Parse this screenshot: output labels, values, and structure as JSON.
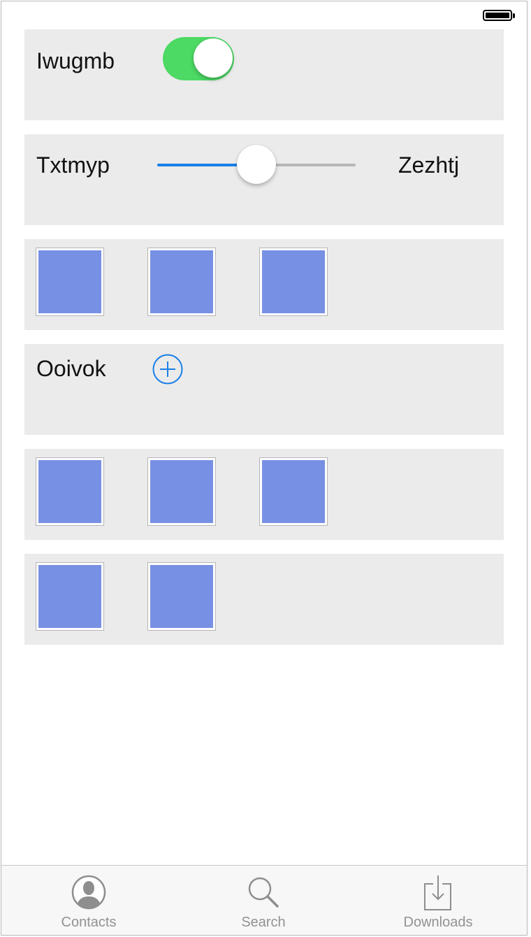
{
  "status_bar": {
    "battery_icon": "battery-icon",
    "battery_level": 1.0
  },
  "rows": {
    "toggle_row": {
      "label": "Iwugmb",
      "toggle_on": true,
      "toggle_color": "#4cd964"
    },
    "slider_row": {
      "left_label": "Txtmyp",
      "right_label": "Zezhtj",
      "value_fraction": 0.5,
      "accent_color": "#1a7fe8"
    },
    "image_row_1": {
      "tile_count": 3
    },
    "add_row": {
      "label": "Ooivok",
      "add_icon": "plus-circle-icon",
      "accent_color": "#1a7fe8"
    },
    "image_row_2": {
      "tile_count": 3
    },
    "image_row_3": {
      "tile_count": 2
    }
  },
  "tile_color": "#7890e4",
  "tabbar": {
    "tabs": [
      {
        "label": "Contacts",
        "icon": "contact-icon"
      },
      {
        "label": "Search",
        "icon": "search-icon"
      },
      {
        "label": "Downloads",
        "icon": "download-icon"
      }
    ]
  }
}
